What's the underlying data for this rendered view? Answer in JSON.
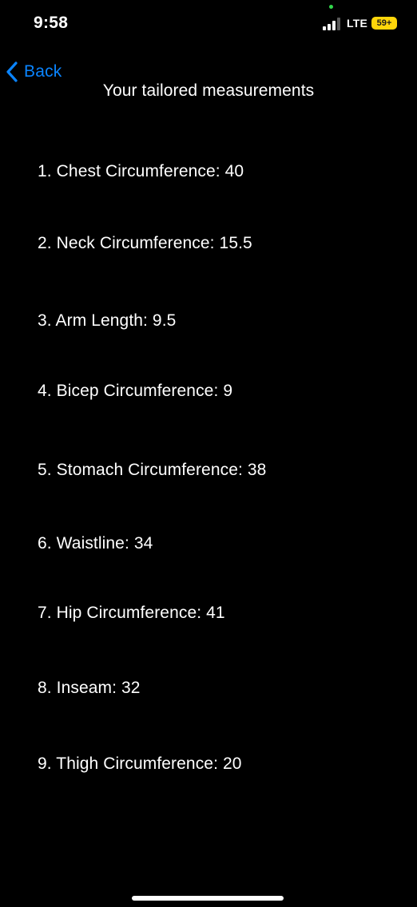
{
  "status_bar": {
    "time": "9:58",
    "network": "LTE",
    "battery": "59+",
    "signal_icon": "cellular-signal-icon",
    "camera_indicator_color": "#32d74b",
    "battery_color": "#ffd60a"
  },
  "nav": {
    "back_label": "Back",
    "back_icon": "chevron-left-icon",
    "title": "Your tailored measurements",
    "accent_color": "#0a84ff"
  },
  "measurements": [
    {
      "text": "1. Chest Circumference: 40"
    },
    {
      "text": "2. Neck Circumference: 15.5"
    },
    {
      "text": "3. Arm Length: 9.5"
    },
    {
      "text": "4. Bicep Circumference: 9"
    },
    {
      "text": "5. Stomach Circumference: 38"
    },
    {
      "text": "6. Waistline: 34"
    },
    {
      "text": "7. Hip Circumference: 41"
    },
    {
      "text": "8. Inseam: 32"
    },
    {
      "text": "9. Thigh Circumference: 20"
    }
  ]
}
